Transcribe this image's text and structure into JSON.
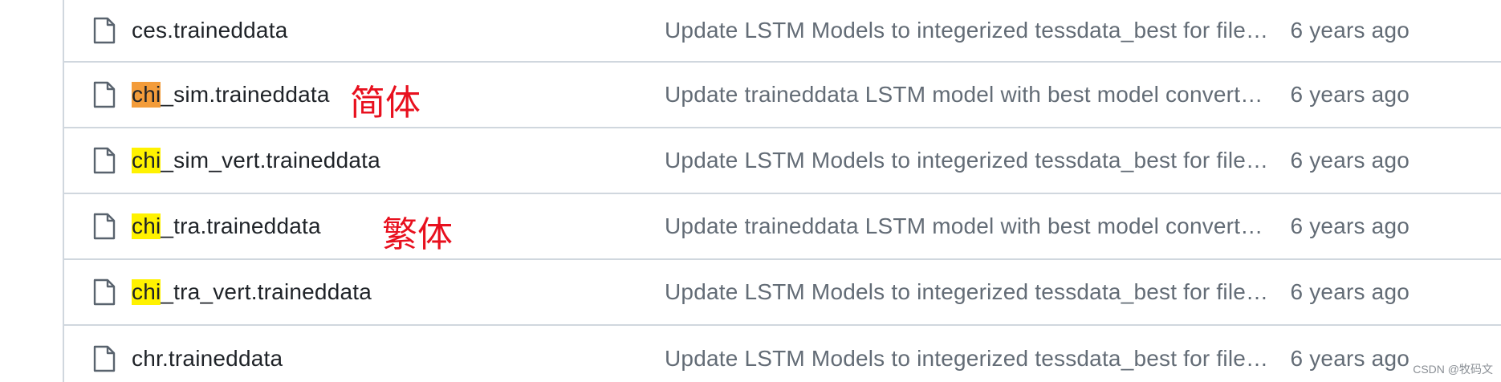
{
  "files": [
    {
      "prefix": "",
      "highlight": "",
      "rest": "ces.traineddata",
      "commit": "Update LSTM Models to integerized tessdata_best for file…",
      "age": "6 years ago"
    },
    {
      "prefix": "",
      "highlight": "chi",
      "rest": "_sim.traineddata",
      "commit": "Update traineddata LSTM model with best model convert…",
      "age": "6 years ago"
    },
    {
      "prefix": "",
      "highlight": "chi",
      "rest": "_sim_vert.traineddata",
      "commit": "Update LSTM Models to integerized tessdata_best for file…",
      "age": "6 years ago"
    },
    {
      "prefix": "",
      "highlight": "chi",
      "rest": "_tra.traineddata",
      "commit": "Update traineddata LSTM model with best model convert…",
      "age": "6 years ago"
    },
    {
      "prefix": "",
      "highlight": "chi",
      "rest": "_tra_vert.traineddata",
      "commit": "Update LSTM Models to integerized tessdata_best for file…",
      "age": "6 years ago"
    },
    {
      "prefix": "",
      "highlight": "",
      "rest": "chr.traineddata",
      "commit": "Update LSTM Models to integerized tessdata_best for file…",
      "age": "6 years ago"
    }
  ],
  "annotations": {
    "simplified": "简体",
    "traditional": "繁体"
  },
  "watermark": "CSDN @牧码文",
  "colors": {
    "highlight_active": "#f39c3a",
    "highlight_match": "#fff200",
    "annotation": "#e8101e"
  },
  "icons": {
    "file": "file-icon"
  }
}
